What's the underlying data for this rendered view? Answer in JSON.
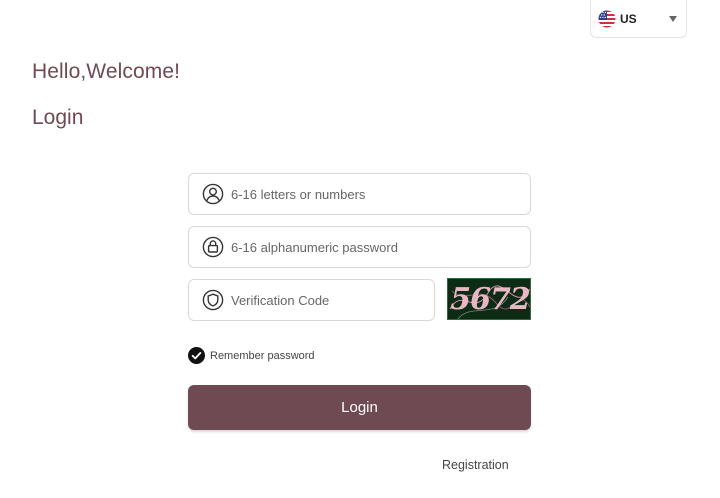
{
  "language": {
    "selected": "US",
    "icon": "us-flag-icon",
    "dropdown_icon": "caret-down-icon"
  },
  "greeting": "Hello,Welcome!",
  "heading": "Login",
  "form": {
    "username": {
      "placeholder": "6-16 letters or numbers",
      "value": "",
      "icon": "user-icon"
    },
    "password": {
      "placeholder": "6-16 alphanumeric password",
      "value": "",
      "icon": "lock-icon"
    },
    "verification": {
      "placeholder": "Verification Code",
      "value": "",
      "icon": "shield-icon"
    },
    "captcha_text": "5672",
    "remember": {
      "label": "Remember password",
      "checked": true
    },
    "submit_label": "Login",
    "registration_link": "Registration"
  },
  "colors": {
    "accent": "#6f4a52",
    "captcha_bg": "#0e2b16",
    "captcha_text": "#e7b7c3"
  }
}
